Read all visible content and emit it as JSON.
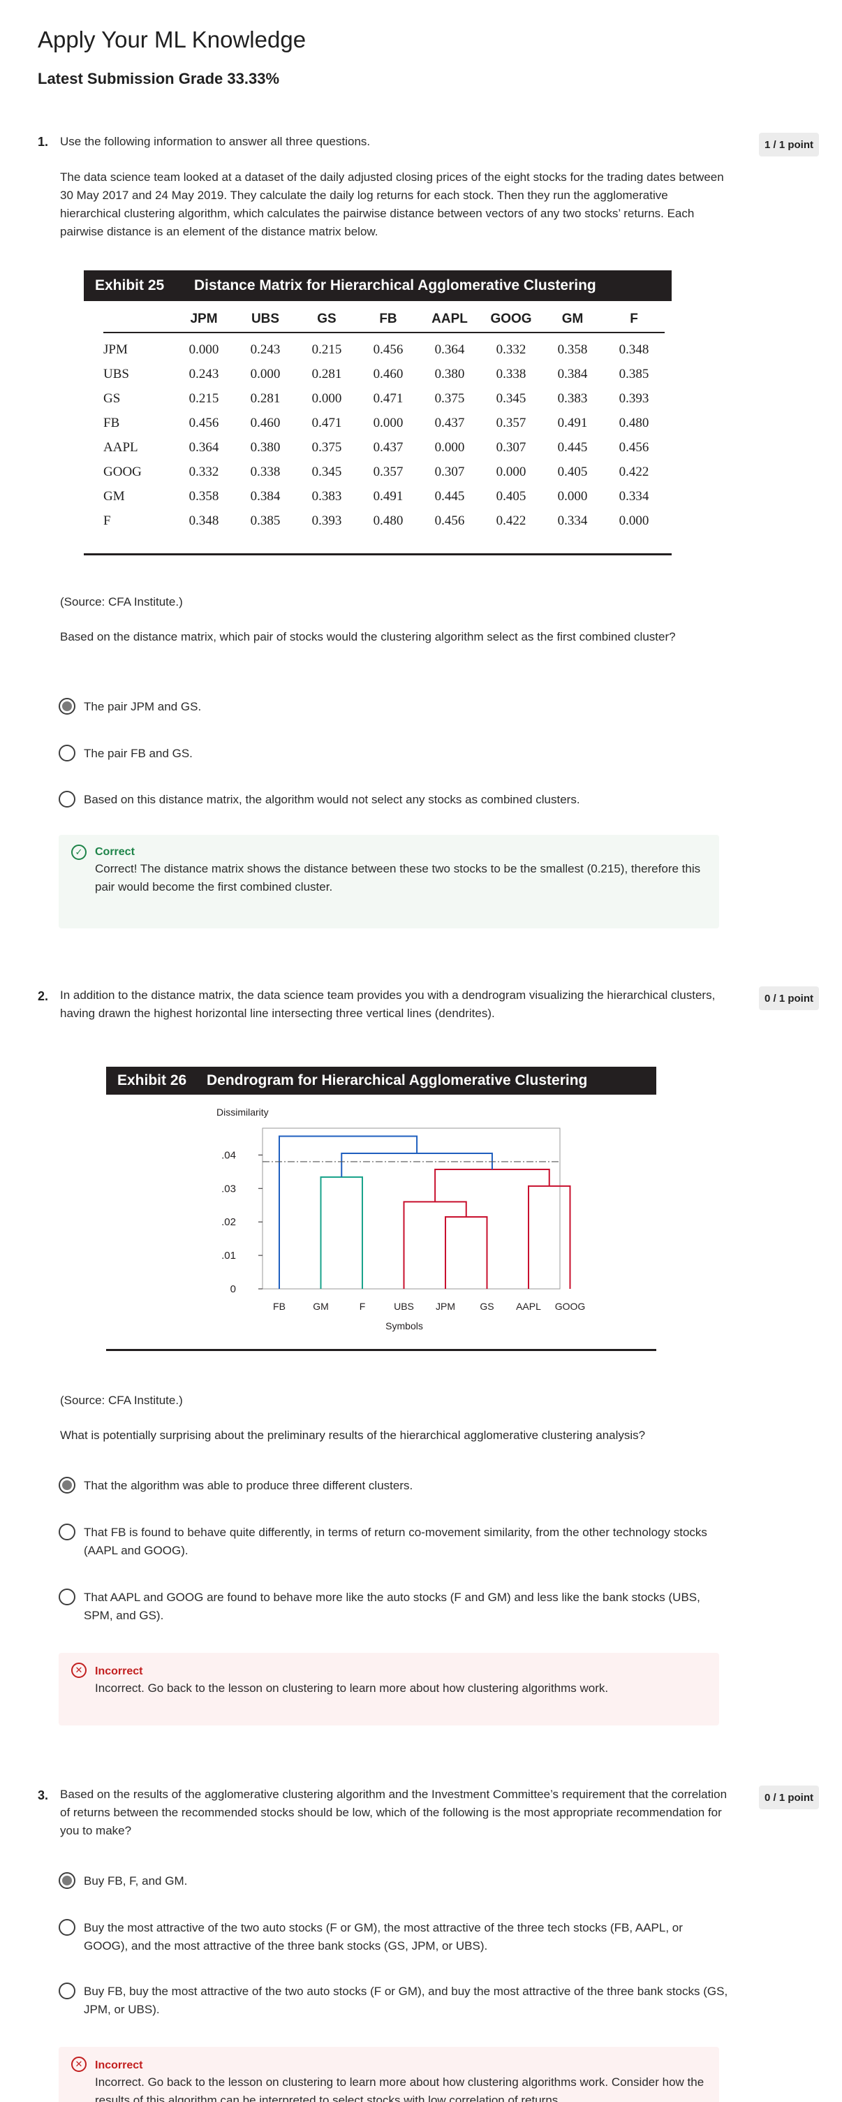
{
  "page": {
    "title": "Apply Your ML Knowledge",
    "grade": "Latest Submission Grade 33.33%"
  },
  "q1": {
    "number": "1.",
    "points": "1 / 1 point",
    "intro": "Use the following information to answer all three questions.",
    "context": "The data science team looked at a dataset of the daily adjusted closing prices of the eight stocks for the trading dates between 30 May 2017 and 24 May 2019. They calculate the daily log returns for each stock. Then they run the agglomerative hierarchical clustering algorithm, which calculates the pairwise distance between vectors of any two stocks’ returns. Each pairwise distance is an element of the distance matrix below.",
    "exhibit": {
      "number": "Exhibit 25",
      "title": "Distance Matrix for Hierarchical Agglomerative Clustering",
      "columns": [
        "JPM",
        "UBS",
        "GS",
        "FB",
        "AAPL",
        "GOOG",
        "GM",
        "F"
      ],
      "rows": [
        {
          "label": "JPM",
          "values": [
            "0.000",
            "0.243",
            "0.215",
            "0.456",
            "0.364",
            "0.332",
            "0.358",
            "0.348"
          ]
        },
        {
          "label": "UBS",
          "values": [
            "0.243",
            "0.000",
            "0.281",
            "0.460",
            "0.380",
            "0.338",
            "0.384",
            "0.385"
          ]
        },
        {
          "label": "GS",
          "values": [
            "0.215",
            "0.281",
            "0.000",
            "0.471",
            "0.375",
            "0.345",
            "0.383",
            "0.393"
          ]
        },
        {
          "label": "FB",
          "values": [
            "0.456",
            "0.460",
            "0.471",
            "0.000",
            "0.437",
            "0.357",
            "0.491",
            "0.480"
          ]
        },
        {
          "label": "AAPL",
          "values": [
            "0.364",
            "0.380",
            "0.375",
            "0.437",
            "0.000",
            "0.307",
            "0.445",
            "0.456"
          ]
        },
        {
          "label": "GOOG",
          "values": [
            "0.332",
            "0.338",
            "0.345",
            "0.357",
            "0.307",
            "0.000",
            "0.405",
            "0.422"
          ]
        },
        {
          "label": "GM",
          "values": [
            "0.358",
            "0.384",
            "0.383",
            "0.491",
            "0.445",
            "0.405",
            "0.000",
            "0.334"
          ]
        },
        {
          "label": "F",
          "values": [
            "0.348",
            "0.385",
            "0.393",
            "0.480",
            "0.456",
            "0.422",
            "0.334",
            "0.000"
          ]
        }
      ]
    },
    "source": "(Source: CFA Institute.)",
    "question": "Based on the distance matrix, which pair of stocks would the clustering algorithm select as the first combined cluster?",
    "options": [
      {
        "label": "The pair JPM and GS.",
        "selected": true
      },
      {
        "label": "The pair FB and GS.",
        "selected": false
      },
      {
        "label": "Based on this distance matrix, the algorithm would not select any stocks as combined clusters.",
        "selected": false
      }
    ],
    "feedback": {
      "status": "correct",
      "icon": "check-icon",
      "title": "Correct",
      "text": "Correct! The distance matrix shows the distance between these two stocks to be the smallest (0.215), therefore this pair would become the first combined cluster."
    }
  },
  "q2": {
    "number": "2.",
    "points": "0 / 1 point",
    "intro": "In addition to the distance matrix, the data science team provides you with a dendrogram visualizing the hierarchical clusters, having drawn the highest horizontal line intersecting three vertical lines (dendrites).",
    "exhibit": {
      "number": "Exhibit 26",
      "title": "Dendrogram for Hierarchical Agglomerative Clustering"
    },
    "source": "(Source: CFA Institute.)",
    "question": "What is potentially surprising about the preliminary results of the hierarchical agglomerative clustering analysis?",
    "options": [
      {
        "label": "That the algorithm was able to produce three different clusters.",
        "selected": true
      },
      {
        "label": "That FB is found to behave quite differently, in terms of return co-movement similarity, from the other technology stocks (AAPL and GOOG).",
        "selected": false
      },
      {
        "label": "That AAPL and GOOG are found to behave more like the auto stocks (F and GM) and less like the bank stocks (UBS, SPM, and GS).",
        "selected": false
      }
    ],
    "feedback": {
      "status": "incorrect",
      "icon": "x-icon",
      "title": "Incorrect",
      "text": "Incorrect. Go back to the lesson on clustering to learn more about how clustering algorithms work."
    }
  },
  "q3": {
    "number": "3.",
    "points": "0 / 1 point",
    "intro": "Based on the results of the agglomerative clustering algorithm and the Investment Committee’s requirement that the correlation of returns between the recommended stocks should be low, which of the following is the most appropriate recommendation for you to make?",
    "options": [
      {
        "label": "Buy FB, F, and GM.",
        "selected": true
      },
      {
        "label": "Buy the most attractive of the two auto stocks (F or GM), the most attractive of the three tech stocks (FB, AAPL, or GOOG), and the most attractive of the three bank stocks (GS, JPM, or UBS).",
        "selected": false
      },
      {
        "label": "Buy FB, buy the most attractive of the two auto stocks (F or GM), and buy the most attractive of the three bank stocks (GS, JPM, or UBS).",
        "selected": false
      }
    ],
    "feedback": {
      "status": "incorrect",
      "icon": "x-icon",
      "title": "Incorrect",
      "text": "Incorrect. Go back to the lesson on clustering to learn more about how clustering algorithms work. Consider how the results of this algorithm can be interpreted to select stocks with low correlation of returns."
    }
  },
  "chart_data": {
    "type": "dendrogram",
    "ylabel": "Dissimilarity",
    "xlabel": "Symbols",
    "leaves": [
      "FB",
      "GM",
      "F",
      "UBS",
      "JPM",
      "GS",
      "AAPL",
      "GOOG"
    ],
    "yticks": [
      ".04",
      ".03",
      ".02",
      ".01",
      "0"
    ],
    "ylim": [
      0,
      0.048
    ],
    "cut_height": 0.038,
    "merges": [
      {
        "left": "JPM",
        "right": "GS",
        "height": 0.0215,
        "color": "#c8102e"
      },
      {
        "left": "UBS",
        "right": "JPM+GS",
        "height": 0.026,
        "color": "#c8102e"
      },
      {
        "left": "AAPL",
        "right": "GOOG",
        "height": 0.0307,
        "color": "#c8102e"
      },
      {
        "left": "GM",
        "right": "F",
        "height": 0.0334,
        "color": "#1aa38b"
      },
      {
        "left": "UBS+JPM+GS",
        "right": "AAPL+GOOG",
        "height": 0.0357,
        "color": "#c8102e"
      },
      {
        "left": "GM+F",
        "right": "banks+tech",
        "height": 0.0405,
        "color": "#1f5fbf"
      },
      {
        "left": "FB",
        "right": "rest",
        "height": 0.0456,
        "color": "#1f5fbf"
      }
    ],
    "colors": {
      "cluster_auto": "#1aa38b",
      "cluster_banks_tech": "#c8102e",
      "links": "#1f5fbf",
      "cut_line": "#555555"
    }
  }
}
